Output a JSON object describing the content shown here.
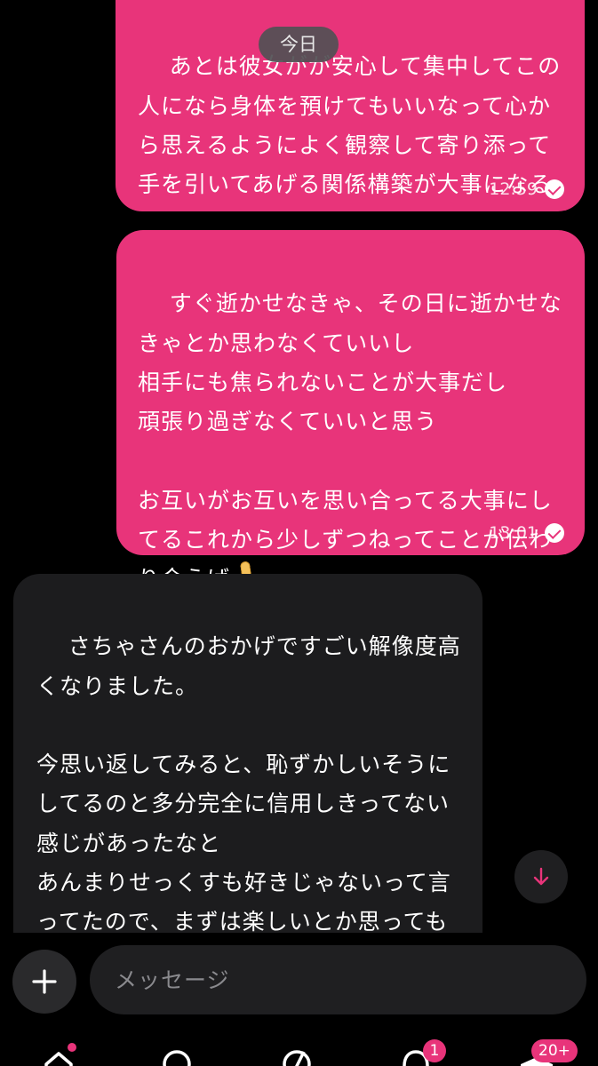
{
  "date_separator": "今日",
  "messages": [
    {
      "direction": "outgoing",
      "text": "あとは彼女がが安心して集中してこの人になら身体を預けてもいいなって心から思えるようによく観察して寄り添って手を引いてあげる関係構築が大事になる",
      "time": "12:59",
      "status": "read"
    },
    {
      "direction": "outgoing",
      "text": "すぐ逝かせなきゃ、その日に逝かせなきゃとか思わなくていいし\n相手にも焦られないことが大事だし\n頑張り過ぎなくていいと思う\n\nお互いがお互いを思い合ってる大事にしてるこれから少しずつねってことが伝わり会えば",
      "emoji": "thumbs-up",
      "time": "13:01",
      "status": "read"
    },
    {
      "direction": "incoming",
      "text": "さちゃさんのおかげですごい解像度高くなりました。\n\n今思い返してみると、恥ずかしいそうにしてるのと多分完全に信用しきってない感じがあったなと\nあんまりせっくすも好きじゃないって言ってたので、まずは楽しいとか思ってもらえるようにします！"
    }
  ],
  "composer": {
    "placeholder": "メッセージ"
  },
  "tabbar": {
    "items": [
      {
        "icon": "home-icon",
        "has_dot": true
      },
      {
        "icon": "search-icon"
      },
      {
        "icon": "compass-icon"
      },
      {
        "icon": "bell-icon",
        "badge": "1"
      },
      {
        "icon": "mail-icon",
        "badge": "20+"
      }
    ]
  },
  "colors": {
    "accent": "#e8347a",
    "incoming_bubble": "#1c1c1e",
    "background": "#000000"
  }
}
